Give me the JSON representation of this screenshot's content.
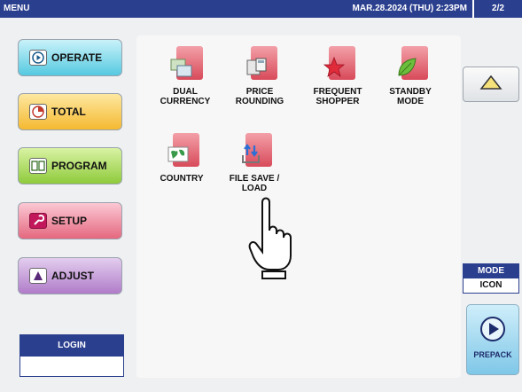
{
  "header": {
    "title": "MENU",
    "datetime": "MAR.28.2024 (THU)  2:23PM",
    "page": "2/2"
  },
  "left_menu": {
    "operate": "OPERATE",
    "total": "TOTAL",
    "program": "PROGRAM",
    "setup": "SETUP",
    "adjust": "ADJUST"
  },
  "login": {
    "label": "LOGIN",
    "value": ""
  },
  "functions": [
    {
      "label": "DUAL\nCURRENCY",
      "icon": "dual-currency-icon"
    },
    {
      "label": "PRICE\nROUNDING",
      "icon": "calculator-icon"
    },
    {
      "label": "FREQUENT\nSHOPPER",
      "icon": "star-icon"
    },
    {
      "label": "STANDBY\nMODE",
      "icon": "leaf-icon"
    },
    {
      "label": "COUNTRY",
      "icon": "globe-icon"
    },
    {
      "label": "FILE SAVE /\nLOAD",
      "icon": "file-transfer-icon"
    }
  ],
  "right_panel": {
    "mode_label": "MODE",
    "mode_value": "ICON",
    "prepack_label": "PREPACK"
  },
  "colors": {
    "header": "#2b3f8f",
    "operate": "#55c9e0",
    "total": "#f5b931",
    "program": "#8fcb3c",
    "setup": "#e5687f",
    "adjust": "#b07cc9"
  }
}
